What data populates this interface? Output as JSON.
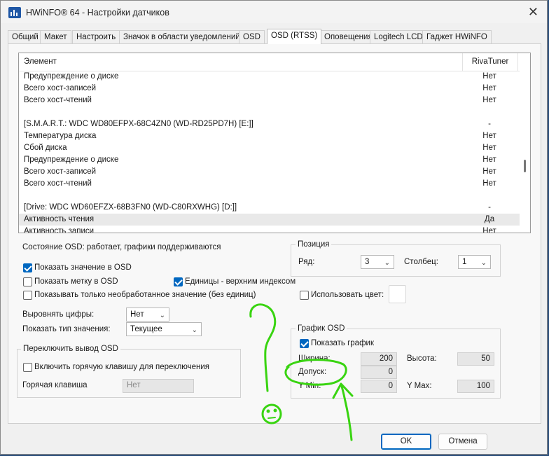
{
  "window": {
    "title": "HWiNFO® 64 - Настройки датчиков",
    "close_glyph": "✕"
  },
  "tabs": [
    {
      "label": "Общий"
    },
    {
      "label": "Макет"
    },
    {
      "label": "Настроить"
    },
    {
      "label": "Значок в области уведомлений"
    },
    {
      "label": "OSD"
    },
    {
      "label": "OSD (RTSS)"
    },
    {
      "label": "Оповещения"
    },
    {
      "label": "Logitech LCD"
    },
    {
      "label": "Гаджет HWiNFO"
    }
  ],
  "list": {
    "col_element": "Элемент",
    "col_riva": "RivaTuner",
    "rows": [
      {
        "name": "Предупреждение о диске",
        "value": "Нет"
      },
      {
        "name": "Всего хост-записей",
        "value": "Нет"
      },
      {
        "name": "Всего хост-чтений",
        "value": "Нет"
      },
      {
        "name": "",
        "value": ""
      },
      {
        "name": "[S.M.A.R.T.: WDC WD80EFPX-68C4ZN0 (WD-RD25PD7H) [E:]]",
        "value": "-"
      },
      {
        "name": "Температура диска",
        "value": "Нет"
      },
      {
        "name": "Сбой диска",
        "value": "Нет"
      },
      {
        "name": "Предупреждение о диске",
        "value": "Нет"
      },
      {
        "name": "Всего хост-записей",
        "value": "Нет"
      },
      {
        "name": "Всего хост-чтений",
        "value": "Нет"
      },
      {
        "name": "",
        "value": ""
      },
      {
        "name": "[Drive: WDC WD60EFZX-68B3FN0 (WD-C80RXWHG) [D:]]",
        "value": "-"
      },
      {
        "name": "Активность чтения",
        "value": "Да"
      },
      {
        "name": "Активность записи",
        "value": "Нет"
      }
    ]
  },
  "osd": {
    "status": "Состояние OSD: работает, графики поддерживаются",
    "show_value": "Показать значение в OSD",
    "show_label": "Показать метку в OSD",
    "units_superscript": "Единицы - верхним индексом",
    "raw_only": "Показывать только необработанное значение (без единиц)",
    "align_label": "Выровнять цифры:",
    "align_value": "Нет",
    "value_type_label": "Показать тип значения:",
    "value_type_value": "Текущее",
    "use_color": "Использовать цвет:"
  },
  "position": {
    "title": "Позиция",
    "row_label": "Ряд:",
    "row_value": "3",
    "col_label": "Столбец:",
    "col_value": "1"
  },
  "hotkey": {
    "title": "Переключить вывод OSD",
    "enable": "Включить горячую клавишу для переключения",
    "key_label": "Горячая клавиша",
    "key_placeholder": "Нет"
  },
  "graph": {
    "title": "График OSD",
    "show": "Показать график",
    "width_label": "Ширина:",
    "width_value": "200",
    "height_label": "Высота:",
    "height_value": "50",
    "tolerance_label": "Допуск:",
    "tolerance_value": "0",
    "ymin_label": "Y Min:",
    "ymin_value": "0",
    "ymax_label": "Y Max:",
    "ymax_value": "100"
  },
  "buttons": {
    "ok": "OK",
    "cancel": "Отмена"
  },
  "colors": {
    "accent": "#0067c0",
    "annotation": "#39d411"
  }
}
